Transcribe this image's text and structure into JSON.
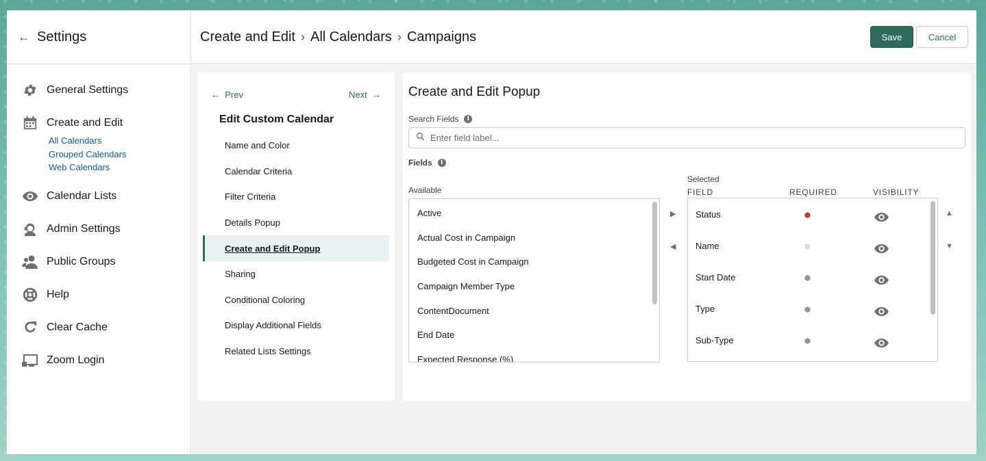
{
  "sidebar": {
    "title": "Settings",
    "items": [
      {
        "label": "General Settings",
        "icon": "gear-icon"
      },
      {
        "label": "Create and Edit",
        "icon": "calendar-icon"
      },
      {
        "label": "Calendar Lists",
        "icon": "eye-icon"
      },
      {
        "label": "Admin Settings",
        "icon": "admin-icon"
      },
      {
        "label": "Public Groups",
        "icon": "group-icon"
      },
      {
        "label": "Help",
        "icon": "lifebuoy-icon"
      },
      {
        "label": "Clear Cache",
        "icon": "refresh-icon"
      },
      {
        "label": "Zoom Login",
        "icon": "screen-icon"
      }
    ],
    "sub_links": [
      "All Calendars",
      "Grouped Calendars",
      "Web Calendars"
    ]
  },
  "header": {
    "breadcrumbs": [
      "Create and Edit",
      "All Calendars",
      "Campaigns"
    ],
    "save_label": "Save",
    "cancel_label": "Cancel"
  },
  "steps": {
    "prev_label": "Prev",
    "next_label": "Next",
    "title": "Edit Custom Calendar",
    "items": [
      "Name and Color",
      "Calendar Criteria",
      "Filter Criteria",
      "Details Popup",
      "Create and Edit Popup",
      "Sharing",
      "Conditional Coloring",
      "Display Additional Fields",
      "Related Lists Settings"
    ],
    "active_index": 4
  },
  "main": {
    "title": "Create and Edit Popup",
    "search_label": "Search Fields",
    "search_placeholder": "Enter field label...",
    "fields_label": "Fields",
    "available_label": "Available",
    "selected_label": "Selected",
    "col_field": "FIELD",
    "col_required": "REQUIRED",
    "col_visibility": "VISIBILITY",
    "available": [
      "Active",
      "Actual Cost in Campaign",
      "Budgeted Cost in Campaign",
      "Campaign Member Type",
      "ContentDocument",
      "End Date",
      "Expected Response (%)"
    ],
    "selected": [
      {
        "name": "Status",
        "required_color": "#c23934"
      },
      {
        "name": "Name",
        "required_color": "#dddbda"
      },
      {
        "name": "Start Date",
        "required_color": "#939393"
      },
      {
        "name": "Type",
        "required_color": "#939393"
      },
      {
        "name": "Sub-Type",
        "required_color": "#939393"
      }
    ]
  },
  "colors": {
    "accent": "#2e6b5e",
    "link": "#0b5cab",
    "active_step_bg": "#e8f3f1"
  }
}
